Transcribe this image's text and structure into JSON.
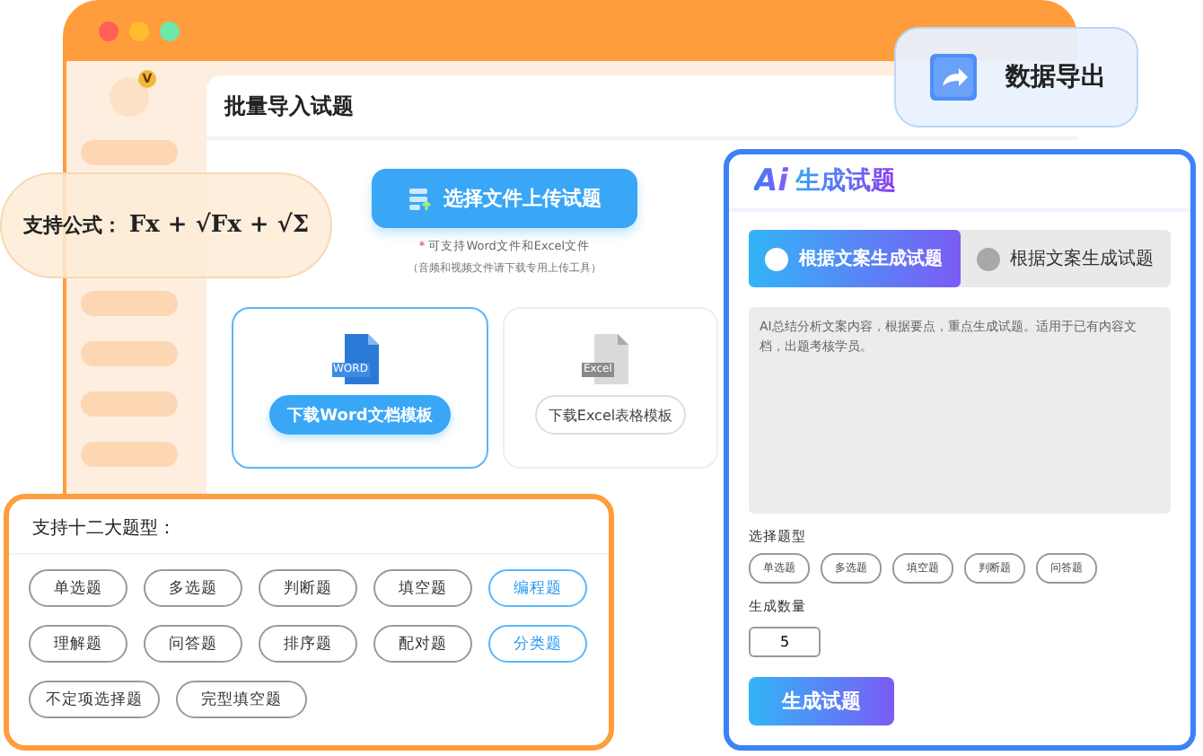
{
  "window": {
    "avatar_badge": "V",
    "title": "批量导入试题",
    "upload_button": "选择文件上传试题",
    "note_mark": "*",
    "note": "可支持Word文件和Excel文件",
    "note_sub": "（音频和视频文件请下载专用上传工具）",
    "templates": [
      {
        "kind": "word",
        "file_label": "WORD",
        "button": "下载Word文档模板",
        "selected": true
      },
      {
        "kind": "excel",
        "file_label": "Excel",
        "button": "下载Excel表格模板",
        "selected": false
      }
    ]
  },
  "formula_badge": {
    "label": "支持公式：",
    "formula": "Fx + √Fx + √Σ"
  },
  "export_badge": {
    "label": "数据导出"
  },
  "ai_panel": {
    "logo": "Ai",
    "title": "生成试题",
    "tabs": [
      {
        "label": "根据文案生成试题",
        "selected": true
      },
      {
        "label": "根据文案生成试题",
        "selected": false
      }
    ],
    "description": "AI总结分析文案内容，根据要点，重点生成试题。适用于已有内容文档，出题考核学员。",
    "type_label": "选择题型",
    "types": [
      "单选题",
      "多选题",
      "填空题",
      "判断题",
      "问答题"
    ],
    "count_label": "生成数量",
    "count": "5",
    "generate_button": "生成试题"
  },
  "types_card": {
    "title": "支持十二大题型：",
    "types": [
      {
        "label": "单选题",
        "selected": false
      },
      {
        "label": "多选题",
        "selected": false
      },
      {
        "label": "判断题",
        "selected": false
      },
      {
        "label": "填空题",
        "selected": false
      },
      {
        "label": "编程题",
        "selected": true
      },
      {
        "label": "理解题",
        "selected": false
      },
      {
        "label": "问答题",
        "selected": false
      },
      {
        "label": "排序题",
        "selected": false
      },
      {
        "label": "配对题",
        "selected": false
      },
      {
        "label": "分类题",
        "selected": true
      },
      {
        "label": "不定项选择题",
        "selected": false
      },
      {
        "label": "完型填空题",
        "selected": false
      }
    ]
  }
}
